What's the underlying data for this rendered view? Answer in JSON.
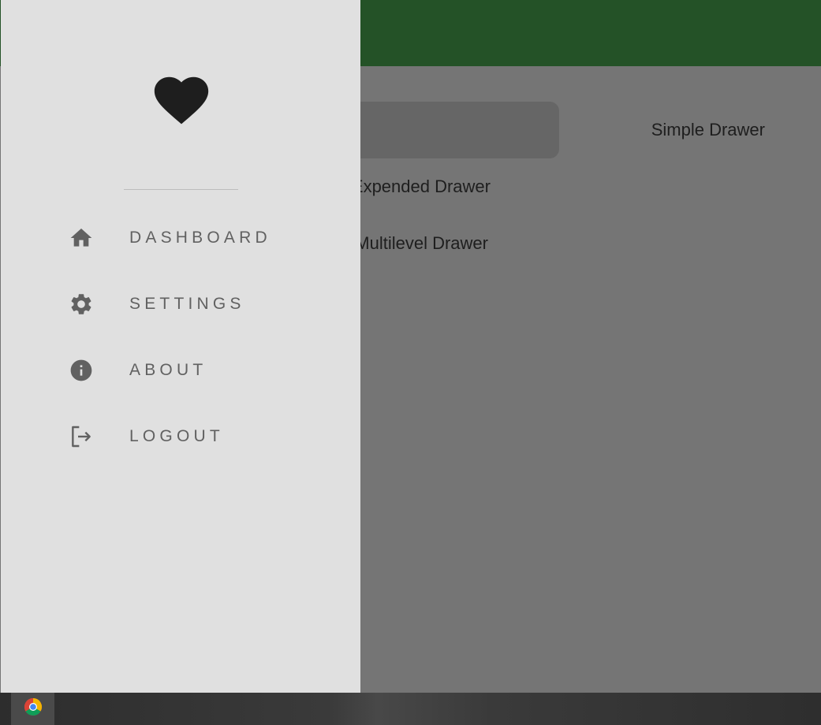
{
  "main": {
    "menu": [
      {
        "label": "Simple Drawer",
        "selected": true
      },
      {
        "label": "Expended Drawer",
        "selected": false
      },
      {
        "label": "Multilevel Drawer",
        "selected": false
      }
    ]
  },
  "drawer": {
    "header_icon": "heart-icon",
    "items": [
      {
        "label": "DASHBOARD",
        "icon": "home-icon"
      },
      {
        "label": "SETTINGS",
        "icon": "gear-icon"
      },
      {
        "label": "ABOUT",
        "icon": "info-icon"
      },
      {
        "label": "LOGOUT",
        "icon": "logout-icon"
      }
    ]
  },
  "taskbar": {
    "apps": [
      {
        "icon": "chrome-icon"
      }
    ]
  },
  "colors": {
    "appbar": "#245227",
    "drawer_bg": "#e0e0e0",
    "scrim": "#757575",
    "icon": "#616161"
  }
}
